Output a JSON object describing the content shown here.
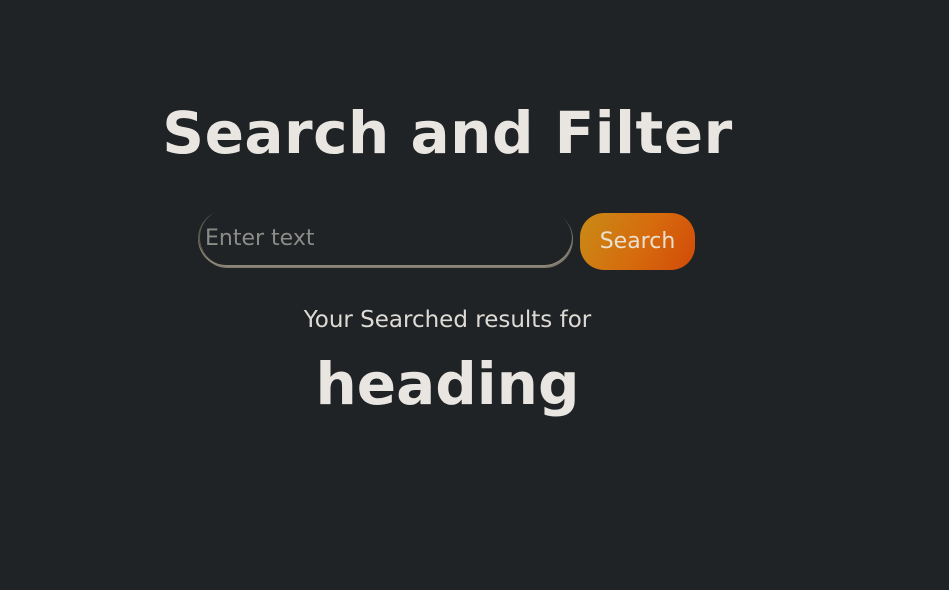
{
  "header": {
    "title": "Search and Filter"
  },
  "search": {
    "placeholder": "Enter text",
    "value": "",
    "button_label": "Search"
  },
  "results": {
    "label": "Your Searched results for",
    "term": "heading"
  },
  "colors": {
    "background": "#202325",
    "text": "#e9e6e2",
    "button_gradient_start": "#c88c16",
    "button_gradient_end": "#d24a08"
  }
}
